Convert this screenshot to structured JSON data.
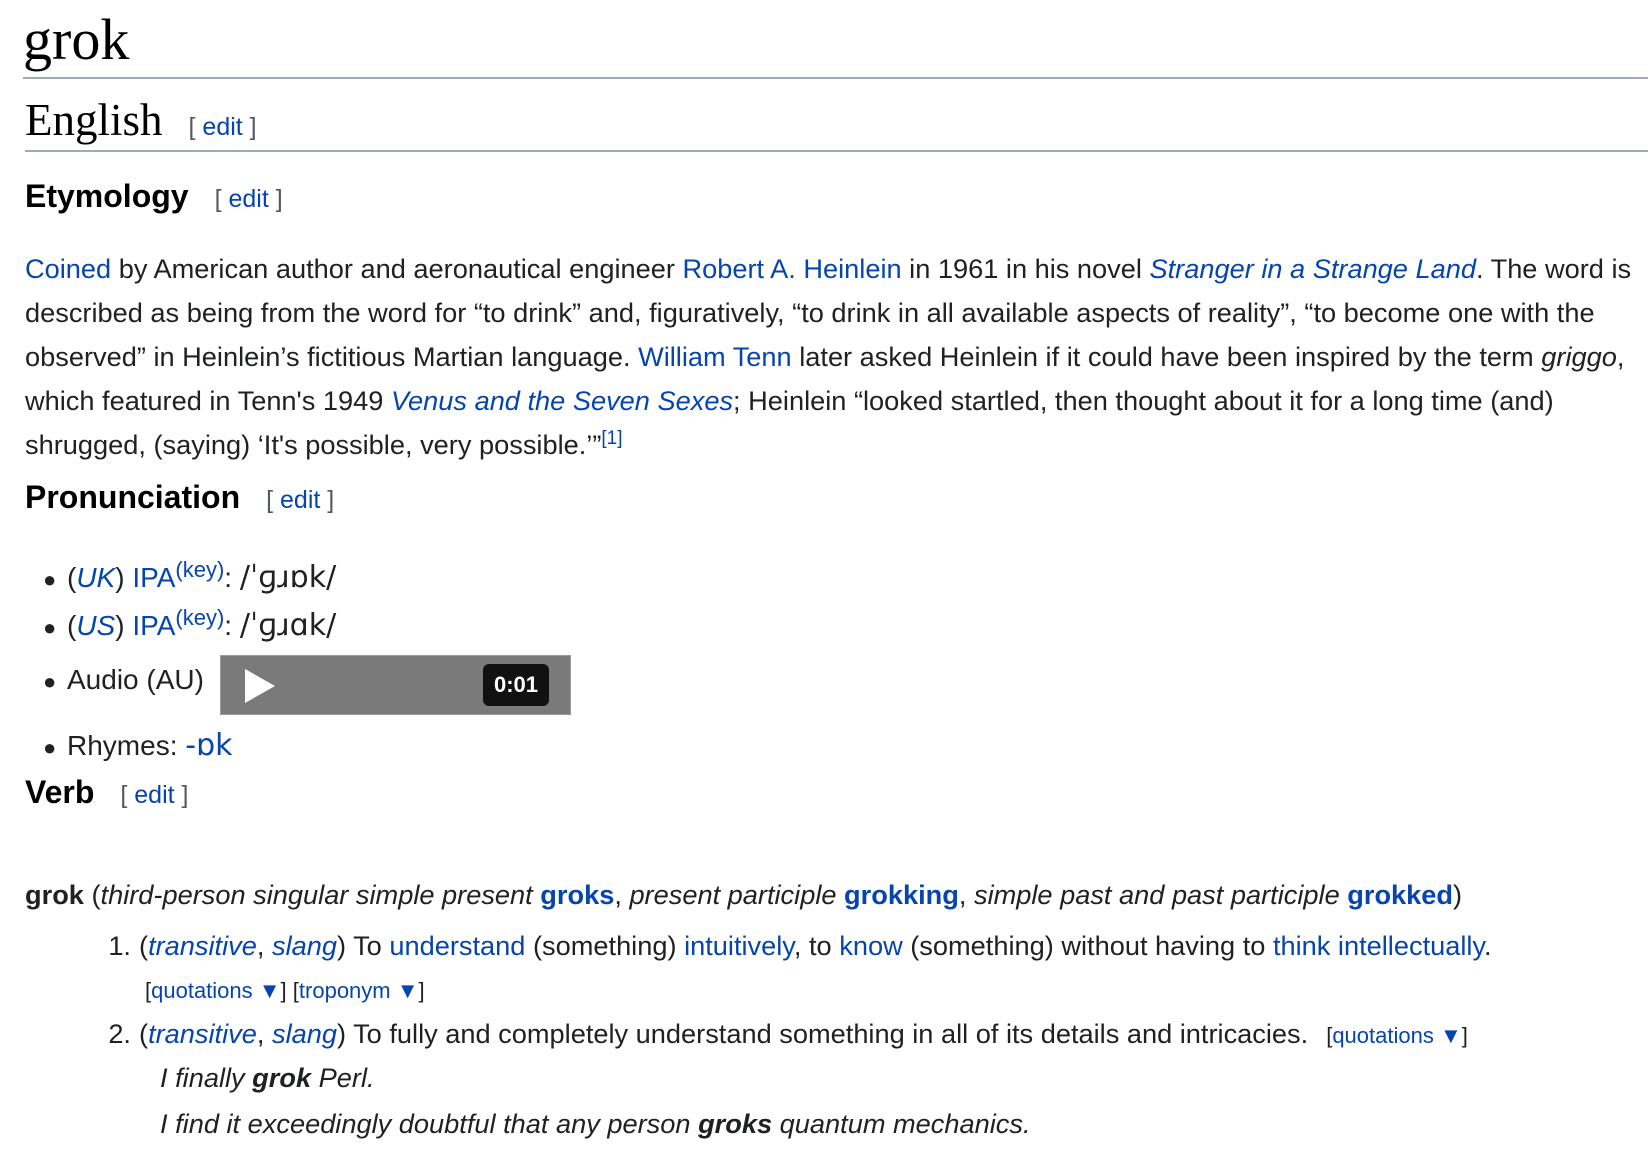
{
  "page": {
    "title": "grok",
    "language_heading": "English",
    "edit_open": "[ ",
    "edit_label": "edit",
    "edit_close": " ]"
  },
  "etymology": {
    "heading": "Etymology",
    "t1_link": "Coined",
    "t2": " by American author and aeronautical engineer ",
    "t3_link": "Robert A. Heinlein",
    "t4": " in 1961 in his novel ",
    "t5_link": "Stranger in a Strange Land",
    "t6": ". The word is described as being from the word for “to drink” and, figuratively, “to drink in all available aspects of reality”, “to become one with the observed” in Heinlein’s fictitious Martian language. ",
    "t7_link": "William Tenn",
    "t8": " later asked Heinlein if it could have been inspired by the term ",
    "t9_italic": "griggo",
    "t10": ", which featured in Tenn's 1949 ",
    "t11_link": "Venus and the Seven Sexes",
    "t12": "; Heinlein “looked startled, then thought about it for a long time (and) shrugged, (saying) ‘It's possible, very possible.’”",
    "ref": "[1]"
  },
  "pronunciation": {
    "heading": "Pronunciation",
    "items": [
      {
        "open": "(",
        "region": "UK",
        "close": ") ",
        "ipa_label": "IPA",
        "key": "(key)",
        "colon": ": ",
        "ipa": "/ˈɡɹɒk/"
      },
      {
        "open": "(",
        "region": "US",
        "close": ") ",
        "ipa_label": "IPA",
        "key": "(key)",
        "colon": ": ",
        "ipa": "/ˈɡɹɑk/"
      }
    ],
    "audio_label": "Audio (AU)",
    "audio_time": "0:01",
    "rhymes_label": "Rhymes: ",
    "rhymes_link": "-ɒk"
  },
  "verb": {
    "heading": "Verb",
    "headword": "grok",
    "h1": " (",
    "h2": "third-person singular simple present",
    "h3": "groks",
    "h4": ", ",
    "h5": "present participle",
    "h6": "grokking",
    "h7": ", ",
    "h8": "simple past and past participle",
    "h9": "grokked",
    "h10": ")",
    "senses": [
      {
        "number": "1.",
        "open": "(",
        "label1": "transitive",
        "comma": ", ",
        "label2": "slang",
        "close": ") ",
        "a": "To ",
        "l1": "understand",
        "b": " (something) ",
        "l2": "intuitively",
        "c": ", to ",
        "l3": "know",
        "d": " (something) without having to ",
        "l4": "think intellectually",
        "e": ".",
        "q_open": "[",
        "q_label": "quotations ▼",
        "q_close": "]",
        "t_open": " [",
        "t_label": "troponym ▼",
        "t_close": "]"
      },
      {
        "number": "2.",
        "open": "(",
        "label1": "transitive",
        "comma": ", ",
        "label2": "slang",
        "close": ") ",
        "text": "To fully and completely understand something in all of its details and intricacies.",
        "q_open": "[",
        "q_label": "quotations ▼",
        "q_close": "]"
      }
    ],
    "examples": [
      {
        "pre": "I finally ",
        "bold": "grok",
        "post": " Perl."
      },
      {
        "pre": "I find it exceedingly doubtful that any person ",
        "bold": "groks",
        "post": " quantum mechanics."
      }
    ]
  }
}
